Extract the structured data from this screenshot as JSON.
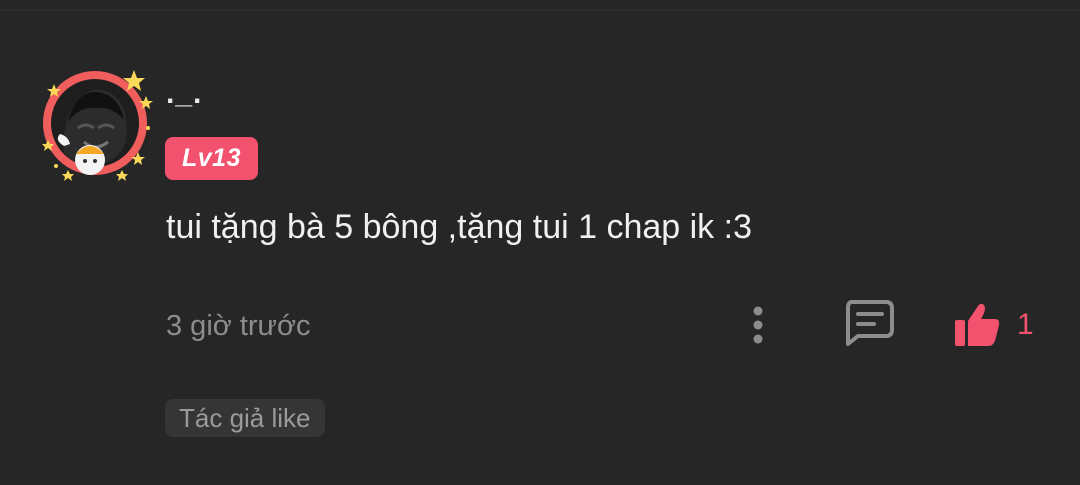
{
  "comment": {
    "username": "._.",
    "level": "Lv13",
    "text": "tui tặng bà 5 bông ,tặng tui 1 chap ik :3",
    "timestamp": "3 giờ trước",
    "like_count": "1",
    "author_like_label": "Tác giả like"
  },
  "icons": {
    "more": "vertical-dots-icon",
    "reply": "chat-bubble-icon",
    "like": "thumbs-up-icon"
  },
  "colors": {
    "background": "#262626",
    "accent": "#f2526e",
    "muted_text": "#8d8d8d",
    "primary_text": "#f0f0f0",
    "badge_bg": "#353535"
  }
}
